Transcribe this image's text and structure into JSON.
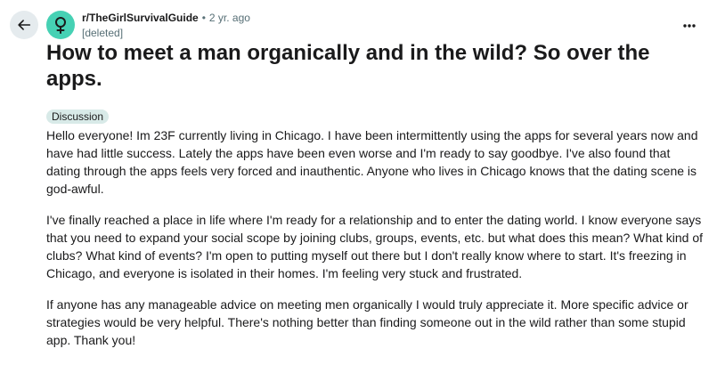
{
  "header": {
    "back_icon": "arrow-left-icon",
    "avatar_icon": "female-symbol-icon",
    "subreddit": "r/TheGirlSurvivalGuide",
    "separator": "•",
    "time": "2 yr. ago",
    "author": "[deleted]",
    "more_icon": "more-horizontal-icon"
  },
  "post": {
    "title": "How to meet a man organically and in the wild? So over the apps.",
    "flair": "Discussion",
    "paragraphs": [
      "Hello everyone! Im 23F currently living in Chicago. I have been intermittently using the apps for several years now and have had little success. Lately the apps have been even worse and I'm ready to say goodbye. I've also found that dating through the apps feels very forced and inauthentic. Anyone who lives in Chicago knows that the dating scene is god-awful.",
      "I've finally reached a place in life where I'm ready for a relationship and to enter the dating world. I know everyone says that you need to expand your social scope by joining clubs, groups, events, etc. but what does this mean? What kind of clubs? What kind of events? I'm open to putting myself out there but I don't really know where to start. It's freezing in Chicago, and everyone is isolated in their homes. I'm feeling very stuck and frustrated.",
      "If anyone has any manageable advice on meeting men organically I would truly appreciate it. More specific advice or strategies would be very helpful. There's nothing better than finding someone out in the wild rather than some stupid app. Thank you!"
    ]
  },
  "colors": {
    "avatar_bg": "#46d1b4",
    "back_button_bg": "#e5ebee",
    "flair_bg": "#d8eae8",
    "meta_text": "#576f76"
  }
}
